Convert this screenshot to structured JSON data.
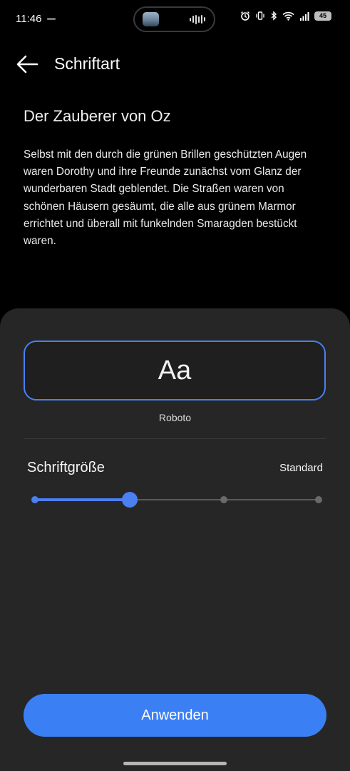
{
  "status_bar": {
    "time": "11:46",
    "battery": "45",
    "icons": [
      "alarm-icon",
      "vibrate-icon",
      "bluetooth-icon",
      "wifi-icon",
      "signal-icon",
      "battery-icon"
    ]
  },
  "header": {
    "back_icon": "arrow-left-icon",
    "title": "Schriftart"
  },
  "preview": {
    "title": "Der Zauberer von Oz",
    "text": "Selbst mit den durch die grünen Brillen geschützten Augen waren Dorothy und ihre Freunde zunächst vom Glanz der wunderbaren Stadt geblendet. Die Straßen waren von schönen Häusern gesäumt, die alle aus grünem Marmor errichtet und überall mit funkelnden Smaragden bestückt waren."
  },
  "font_selector": {
    "sample": "Aa",
    "font_name": "Roboto"
  },
  "font_size": {
    "label": "Schriftgröße",
    "value": "Standard",
    "steps": 4,
    "selected_index": 1
  },
  "actions": {
    "apply_label": "Anwenden"
  },
  "colors": {
    "accent": "#3b7ff5",
    "background": "#000000",
    "sheet": "#262626"
  }
}
